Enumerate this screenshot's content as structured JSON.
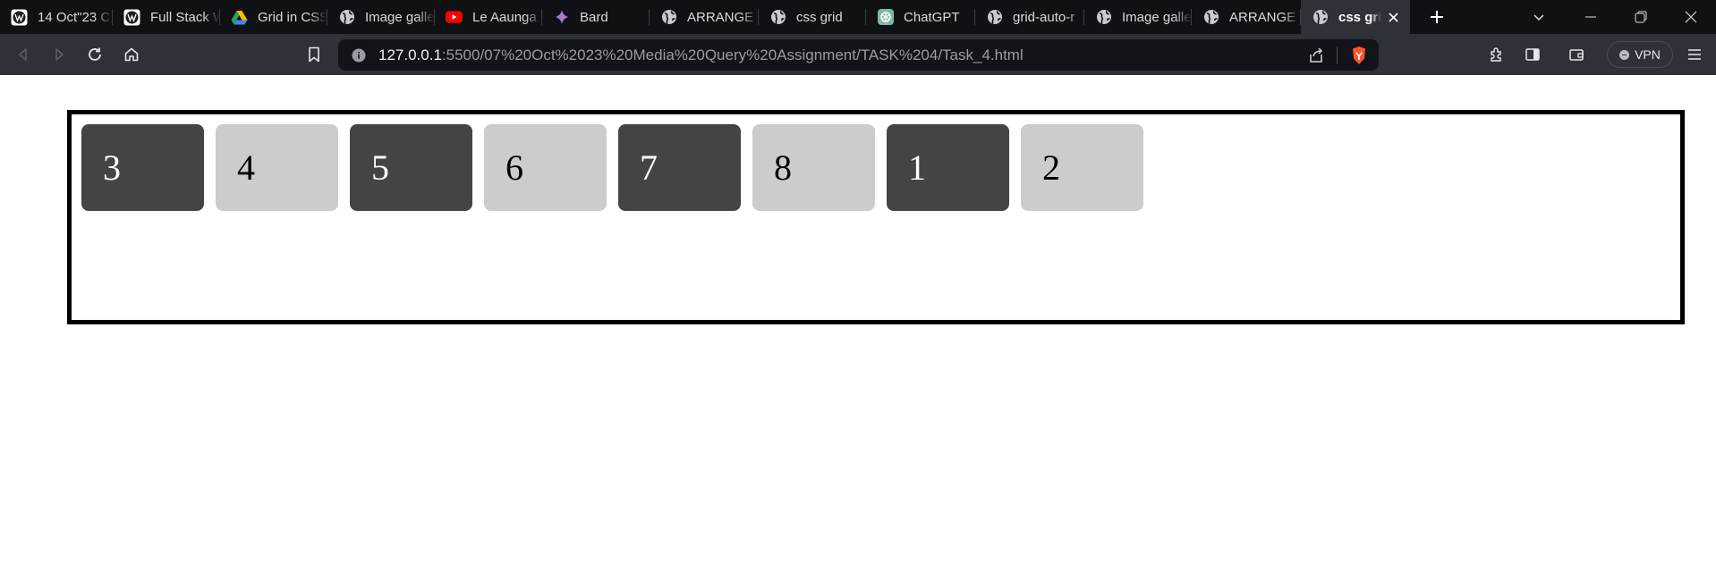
{
  "browser": {
    "tabs": [
      {
        "title": "14 Oct\"23 C",
        "icon": "wp-icon",
        "active": false,
        "width": 126
      },
      {
        "title": "Full Stack W",
        "icon": "wp-icon",
        "active": false,
        "width": 120
      },
      {
        "title": "Grid in CSS",
        "icon": "drive-icon",
        "active": false,
        "width": 120
      },
      {
        "title": "Image galle",
        "icon": "globe-icon",
        "active": false,
        "width": 120
      },
      {
        "title": "Le Aaunga",
        "icon": "youtube-icon",
        "active": false,
        "width": 120
      },
      {
        "title": "Bard",
        "icon": "bard-icon",
        "active": false,
        "width": 120
      },
      {
        "title": "ARRANGE",
        "icon": "globe-icon",
        "active": false,
        "width": 122
      },
      {
        "title": "css grid",
        "icon": "globe-icon",
        "active": false,
        "width": 120
      },
      {
        "title": "ChatGPT",
        "icon": "chatgpt-icon",
        "active": false,
        "width": 122
      },
      {
        "title": "grid-auto-r",
        "icon": "globe-icon",
        "active": false,
        "width": 122
      },
      {
        "title": "Image galle",
        "icon": "globe-icon",
        "active": false,
        "width": 120
      },
      {
        "title": "ARRANGE",
        "icon": "globe-icon",
        "active": false,
        "width": 122
      },
      {
        "title": "css grid",
        "icon": "globe-icon",
        "active": true,
        "width": 122
      }
    ],
    "url_host": "127.0.0.1",
    "url_rest": ":5500/07%20Oct%2023%20Media%20Query%20Assignment/TASK%204/Task_4.html",
    "vpn_label": "VPN",
    "colors": {
      "tabstrip": "#0f1115",
      "toolbar": "#2e3138",
      "omnibox": "#121419",
      "brave_orange": "#fb542b"
    }
  },
  "page": {
    "items": [
      {
        "label": "3",
        "tone": "dark"
      },
      {
        "label": "4",
        "tone": "light"
      },
      {
        "label": "5",
        "tone": "dark"
      },
      {
        "label": "6",
        "tone": "light"
      },
      {
        "label": "7",
        "tone": "dark"
      },
      {
        "label": "8",
        "tone": "light"
      },
      {
        "label": "1",
        "tone": "dark"
      },
      {
        "label": "2",
        "tone": "light"
      }
    ],
    "colors": {
      "dark": "#444444",
      "light": "#cccccc",
      "border": "#000000"
    }
  }
}
